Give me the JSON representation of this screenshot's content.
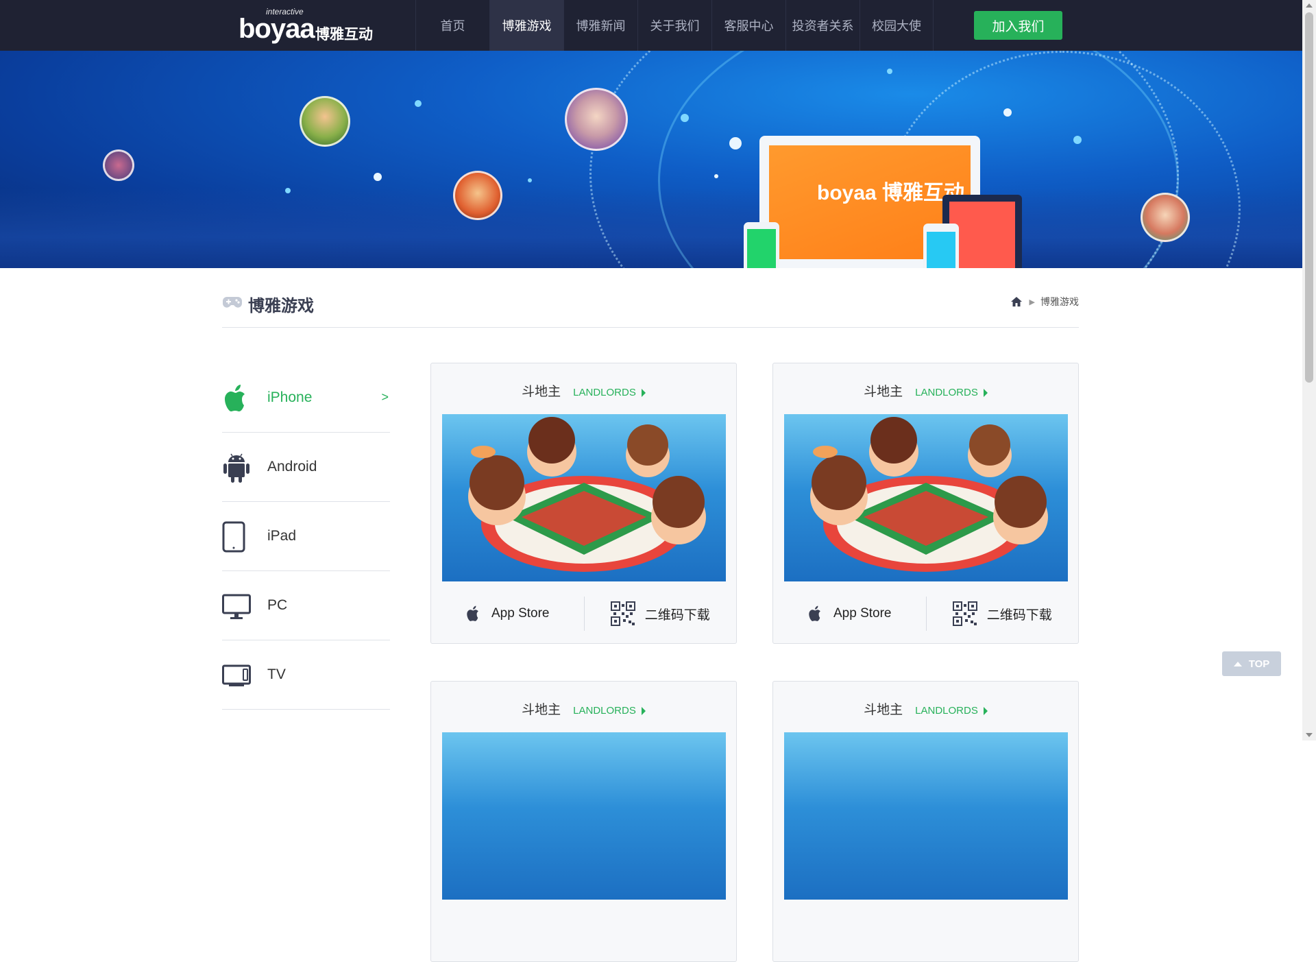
{
  "logo": {
    "small": "interactive",
    "big": "boyaa",
    "cn": "博雅互动"
  },
  "nav": {
    "items": [
      {
        "label": "首页"
      },
      {
        "label": "博雅游戏"
      },
      {
        "label": "博雅新闻"
      },
      {
        "label": "关于我们"
      },
      {
        "label": "客服中心"
      },
      {
        "label": "投资者关系"
      },
      {
        "label": "校园大使"
      }
    ],
    "active_index": 1,
    "join_label": "加入我们"
  },
  "banner": {
    "screen_text": "boyaa 博雅互动"
  },
  "page": {
    "title": "博雅游戏",
    "breadcrumb": "博雅游戏"
  },
  "sidebar": {
    "items": [
      {
        "label": "iPhone",
        "icon": "apple-icon"
      },
      {
        "label": "Android",
        "icon": "android-icon"
      },
      {
        "label": "iPad",
        "icon": "ipad-icon"
      },
      {
        "label": "PC",
        "icon": "monitor-icon"
      },
      {
        "label": "TV",
        "icon": "tv-icon"
      }
    ],
    "active_arrow": ">"
  },
  "cards": [
    {
      "name_cn": "斗地主",
      "name_en": "LANDLORDS",
      "btn_store": "App Store",
      "btn_qr": "二维码下载"
    },
    {
      "name_cn": "斗地主",
      "name_en": "LANDLORDS",
      "btn_store": "App Store",
      "btn_qr": "二维码下载"
    },
    {
      "name_cn": "斗地主",
      "name_en": "LANDLORDS"
    },
    {
      "name_cn": "斗地主",
      "name_en": "LANDLORDS"
    }
  ],
  "top_button": "TOP",
  "colors": {
    "nav_bg": "#1f2233",
    "accent": "#27b15a",
    "banner": "#0f5ec7"
  }
}
